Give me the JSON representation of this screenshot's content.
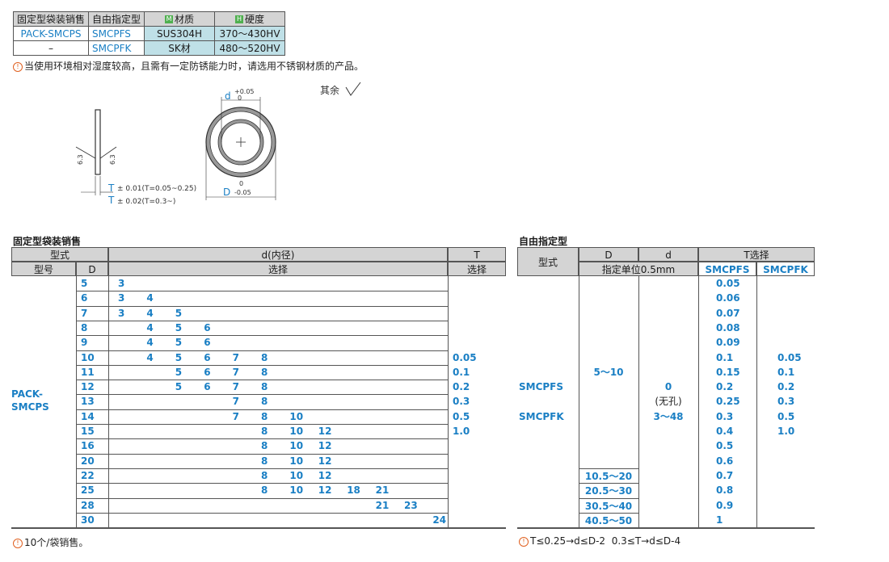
{
  "material_table": {
    "headers": [
      "固定型袋装销售",
      "自由指定型",
      "材质",
      "硬度"
    ],
    "header_badges": [
      "M",
      "H"
    ],
    "rows": [
      [
        "PACK-SMCPS",
        "SMCPFS",
        "SUS304H",
        "370～430HV"
      ],
      [
        "–",
        "SMCPFK",
        "SK材",
        "480～520HV"
      ]
    ]
  },
  "material_note": "当使用环境相对湿度较高，且需有一定防锈能力时，请选用不锈钢材质的产品。",
  "drawing": {
    "roughness_other": "其余",
    "roughness_value": "6.3",
    "d_label": "d",
    "d_tol_upper": "+0.05",
    "d_tol_lower": "0",
    "D_label": "D",
    "D_tol_upper": "0",
    "D_tol_lower": "-0.05",
    "t_label": "T",
    "t_tol_1": "± 0.01(T=0.05~0.25)",
    "t_tol_2": "± 0.02(T=0.3~)"
  },
  "fixed_section": {
    "title": "固定型袋装销售",
    "head_type": "型式",
    "head_d": "d(内径)",
    "head_t": "T",
    "sub_model": "型号",
    "sub_D": "D",
    "sub_select": "选择",
    "sub_t_select": "选择",
    "model": "PACK-\nSMCPS",
    "d_columns": [
      "3",
      "4",
      "5",
      "6",
      "7",
      "8",
      "10",
      "12",
      "18",
      "21",
      "23",
      "24"
    ],
    "rows": [
      {
        "D": "5",
        "d": [
          "3"
        ]
      },
      {
        "D": "6",
        "d": [
          "3",
          "4"
        ]
      },
      {
        "D": "7",
        "d": [
          "3",
          "4",
          "5"
        ]
      },
      {
        "D": "8",
        "d": [
          "4",
          "5",
          "6"
        ]
      },
      {
        "D": "9",
        "d": [
          "4",
          "5",
          "6"
        ]
      },
      {
        "D": "10",
        "d": [
          "4",
          "5",
          "6",
          "7",
          "8"
        ]
      },
      {
        "D": "11",
        "d": [
          "5",
          "6",
          "7",
          "8"
        ]
      },
      {
        "D": "12",
        "d": [
          "5",
          "6",
          "7",
          "8"
        ]
      },
      {
        "D": "13",
        "d": [
          "7",
          "8"
        ]
      },
      {
        "D": "14",
        "d": [
          "7",
          "8",
          "10"
        ]
      },
      {
        "D": "15",
        "d": [
          "8",
          "10",
          "12"
        ]
      },
      {
        "D": "16",
        "d": [
          "8",
          "10",
          "12"
        ]
      },
      {
        "D": "20",
        "d": [
          "8",
          "10",
          "12"
        ]
      },
      {
        "D": "22",
        "d": [
          "8",
          "10",
          "12"
        ]
      },
      {
        "D": "25",
        "d": [
          "8",
          "10",
          "12",
          "18",
          "21"
        ]
      },
      {
        "D": "28",
        "d": [
          "21",
          "23"
        ]
      },
      {
        "D": "30",
        "d": [
          "24"
        ]
      }
    ],
    "t_values": [
      "0.05",
      "0.1",
      "0.2",
      "0.3",
      "0.5",
      "1.0"
    ],
    "note": "10个/袋销售。"
  },
  "free_section": {
    "title": "自由指定型",
    "head_type": "型式",
    "head_D": "D",
    "head_d": "d",
    "head_t": "T选择",
    "sub_unit": "指定单位0.5mm",
    "sub_smcpfs": "SMCPFS",
    "sub_smcpfk": "SMCPFK",
    "types": [
      "SMCPFS",
      "SMCPFK"
    ],
    "D_main": "5～10",
    "D_extra": [
      "10.5～20",
      "20.5～30",
      "30.5～40",
      "40.5～50"
    ],
    "d_values": [
      "0",
      "(无孔)",
      "3～48"
    ],
    "t_smcpfs": [
      "0.05",
      "0.06",
      "0.07",
      "0.08",
      "0.09",
      "0.1",
      "0.15",
      "0.2",
      "0.25",
      "0.3",
      "0.4",
      "0.5",
      "0.6",
      "0.7",
      "0.8",
      "0.9",
      "1"
    ],
    "t_smcpfk": [
      "0.05",
      "0.1",
      "0.2",
      "0.3",
      "0.5",
      "1.0"
    ],
    "note_1": "T≤0.25→d≤D-2",
    "note_2": "0.3≤T→d≤D-4"
  }
}
